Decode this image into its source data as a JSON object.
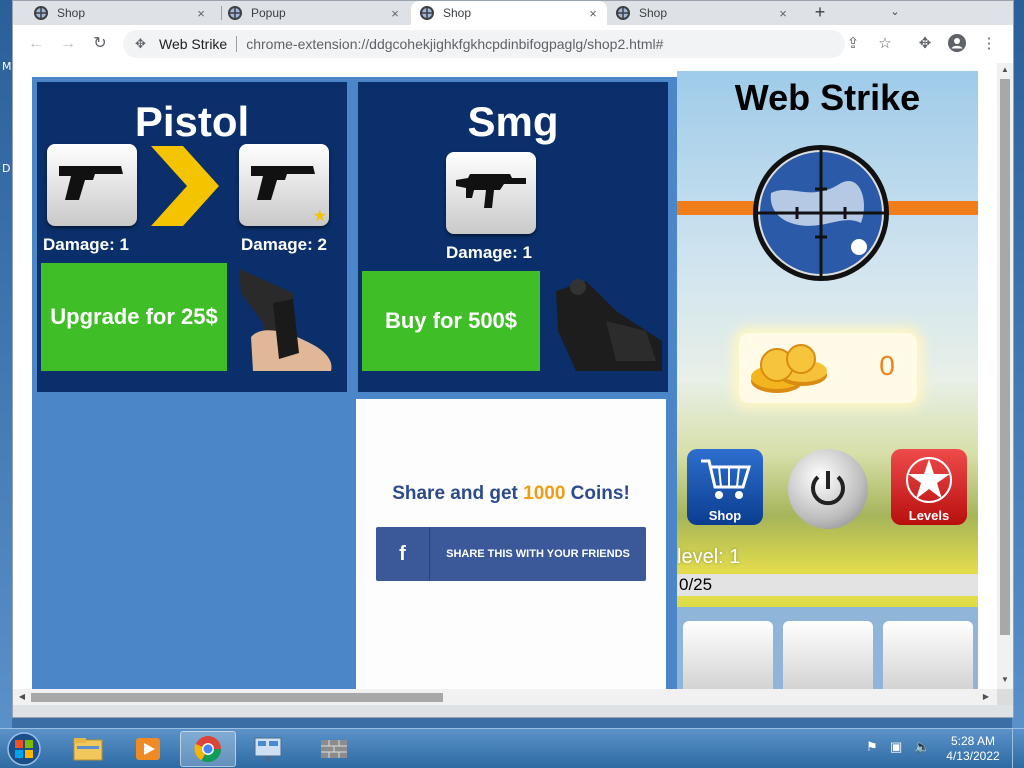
{
  "desktop": {
    "left_letters": [
      "M",
      "D"
    ]
  },
  "browser": {
    "tabs": [
      {
        "title": "Shop",
        "close": "×"
      },
      {
        "title": "Popup",
        "close": "×"
      },
      {
        "title": "Shop",
        "close": "×"
      },
      {
        "title": "Shop",
        "close": "×"
      }
    ],
    "new_tab": "+",
    "tab_menu": "⌄",
    "nav": {
      "back": "←",
      "forward": "→",
      "reload": "↻"
    },
    "omnibox": {
      "site_name": "Web Strike",
      "url": "chrome-extension://ddgcohekjighkfgkhcpdinbifogpaglg/shop2.html#"
    },
    "toolbar_icons": [
      "share-icon",
      "star-icon",
      "extensions-icon",
      "profile-icon",
      "menu-icon"
    ]
  },
  "shop": {
    "pistol": {
      "title": "Pistol",
      "damage_current": "Damage: 1",
      "damage_next": "Damage: 2",
      "upgrade_label": "Upgrade for 25$"
    },
    "smg": {
      "title": "Smg",
      "damage": "Damage: 1",
      "buy_label": "Buy for 500$"
    },
    "share": {
      "text_before": "Share and get ",
      "coins": "1000",
      "text_after": " Coins!",
      "fb_icon": "f",
      "fb_label": "SHARE THIS WITH YOUR FRIENDS"
    }
  },
  "game": {
    "title": "Web Strike",
    "coins": "0",
    "shop_label": "Shop",
    "levels_label": "Levels",
    "level_text": "level: 1",
    "progress_text": "0/25",
    "colors": {
      "accent_orange": "#f07d1a",
      "buy_green": "#3fbe27",
      "card_navy": "#0a2f6a"
    }
  },
  "taskbar": {
    "time": "5:28 AM",
    "date": "4/13/2022",
    "apps": [
      "explorer-icon",
      "media-player-icon",
      "chrome-icon",
      "network-app-icon",
      "firewall-icon"
    ]
  }
}
